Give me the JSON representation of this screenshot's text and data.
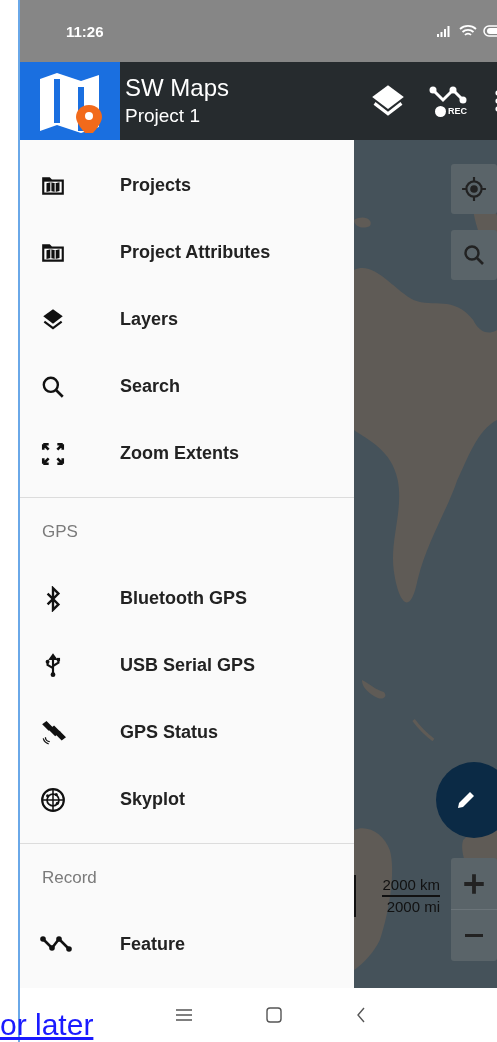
{
  "status_bar": {
    "time": "11:26"
  },
  "app_bar": {
    "title": "SW Maps",
    "subtitle": "Project 1",
    "rec_label": "REC"
  },
  "drawer": {
    "sections": [
      {
        "items": [
          {
            "label": "Projects"
          },
          {
            "label": "Project Attributes"
          },
          {
            "label": "Layers"
          },
          {
            "label": "Search"
          },
          {
            "label": "Zoom Extents"
          }
        ]
      },
      {
        "header": "GPS",
        "items": [
          {
            "label": "Bluetooth GPS"
          },
          {
            "label": "USB Serial GPS"
          },
          {
            "label": "GPS Status"
          },
          {
            "label": "Skyplot"
          }
        ]
      },
      {
        "header": "Record",
        "items": [
          {
            "label": "Feature"
          }
        ]
      }
    ]
  },
  "map": {
    "scale_km": "2000 km",
    "scale_mi": "2000 mi"
  },
  "page_link": "or later"
}
